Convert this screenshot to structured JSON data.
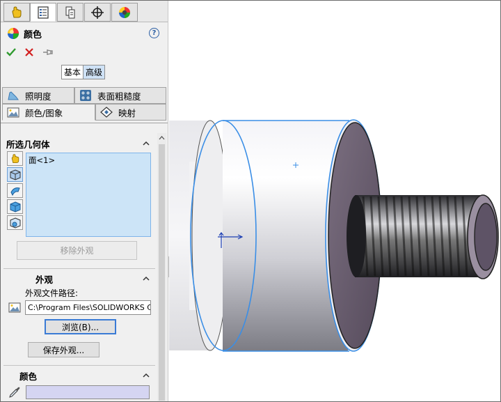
{
  "toolbar_tabs": [
    {
      "icon": "feature-manager-icon",
      "active": false
    },
    {
      "icon": "property-manager-icon",
      "active": true
    },
    {
      "icon": "configuration-manager-icon",
      "active": false
    },
    {
      "icon": "dimxpert-icon",
      "active": false
    },
    {
      "icon": "display-manager-icon",
      "active": false
    }
  ],
  "property_manager": {
    "title": "颜色",
    "help_glyph": "?"
  },
  "mode": {
    "basic_label": "基本",
    "advanced_label": "高级",
    "selected": "高级"
  },
  "prop_tabs": {
    "illumination": "照明度",
    "surface_finish": "表面粗糙度",
    "color_image": "颜色/图象",
    "mapping": "映射"
  },
  "selected_geometry": {
    "title": "所选几何体",
    "items": [
      "面<1>"
    ],
    "remove_button": "移除外观"
  },
  "appearance": {
    "title": "外观",
    "path_label": "外观文件路径:",
    "path_value": "C:\\Program Files\\SOLIDWORKS Corp\\SOLIDWORKS\\data\\graphics\\materials",
    "browse_button": "浏览(B)...",
    "save_button": "保存外观..."
  },
  "color": {
    "title": "颜色",
    "swatch_color": "#d5d5f2"
  },
  "colors": {
    "accent_blue": "#3a8ee6",
    "selection_fill": "#cce4f7",
    "ok_green": "#2e9a2e",
    "cancel_red": "#d21e1e"
  }
}
